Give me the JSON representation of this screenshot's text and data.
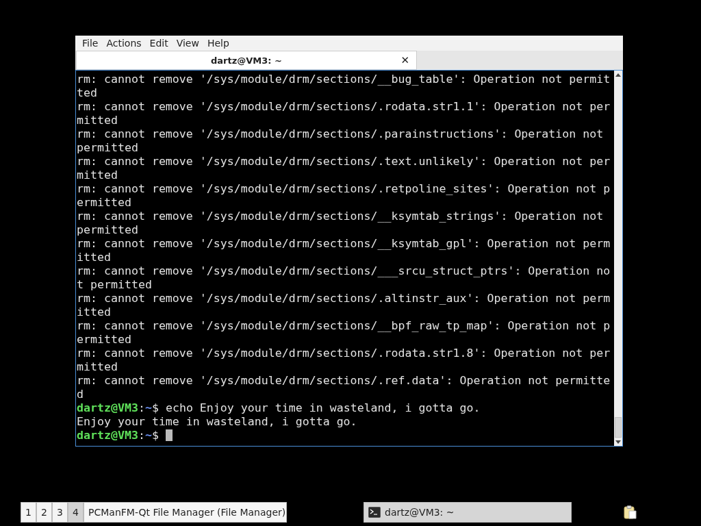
{
  "window": {
    "menu": [
      "File",
      "Actions",
      "Edit",
      "View",
      "Help"
    ],
    "tabs": [
      {
        "label": "dartz@VM3: ~",
        "selected": true,
        "close": "✕"
      }
    ],
    "terminal": {
      "lines": [
        {
          "kind": "output",
          "text": "rm: cannot remove '/sys/module/drm/sections/__bug_table': Operation not permit"
        },
        {
          "kind": "output",
          "text": "ted"
        },
        {
          "kind": "output",
          "text": "rm: cannot remove '/sys/module/drm/sections/.rodata.str1.1': Operation not per"
        },
        {
          "kind": "output",
          "text": "mitted"
        },
        {
          "kind": "output",
          "text": "rm: cannot remove '/sys/module/drm/sections/.parainstructions': Operation not"
        },
        {
          "kind": "output",
          "text": "permitted"
        },
        {
          "kind": "output",
          "text": "rm: cannot remove '/sys/module/drm/sections/.text.unlikely': Operation not per"
        },
        {
          "kind": "output",
          "text": "mitted"
        },
        {
          "kind": "output",
          "text": "rm: cannot remove '/sys/module/drm/sections/.retpoline_sites': Operation not p"
        },
        {
          "kind": "output",
          "text": "ermitted"
        },
        {
          "kind": "output",
          "text": "rm: cannot remove '/sys/module/drm/sections/__ksymtab_strings': Operation not"
        },
        {
          "kind": "output",
          "text": "permitted"
        },
        {
          "kind": "output",
          "text": "rm: cannot remove '/sys/module/drm/sections/__ksymtab_gpl': Operation not perm"
        },
        {
          "kind": "output",
          "text": "itted"
        },
        {
          "kind": "output",
          "text": "rm: cannot remove '/sys/module/drm/sections/___srcu_struct_ptrs': Operation no"
        },
        {
          "kind": "output",
          "text": "t permitted"
        },
        {
          "kind": "output",
          "text": "rm: cannot remove '/sys/module/drm/sections/.altinstr_aux': Operation not perm"
        },
        {
          "kind": "output",
          "text": "itted"
        },
        {
          "kind": "output",
          "text": "rm: cannot remove '/sys/module/drm/sections/__bpf_raw_tp_map': Operation not p"
        },
        {
          "kind": "output",
          "text": "ermitted"
        },
        {
          "kind": "output",
          "text": "rm: cannot remove '/sys/module/drm/sections/.rodata.str1.8': Operation not per"
        },
        {
          "kind": "output",
          "text": "mitted"
        },
        {
          "kind": "output",
          "text": "rm: cannot remove '/sys/module/drm/sections/.ref.data': Operation not permitte"
        },
        {
          "kind": "output",
          "text": "d"
        },
        {
          "kind": "prompt",
          "user": "dartz@VM3",
          "sep": ":",
          "path": "~",
          "symbol": "$",
          "command": "echo Enjoy your time in wasteland, i gotta go."
        },
        {
          "kind": "output",
          "text": "Enjoy your time in wasteland, i gotta go."
        },
        {
          "kind": "prompt",
          "user": "dartz@VM3",
          "sep": ":",
          "path": "~",
          "symbol": "$",
          "cursor": true
        }
      ]
    }
  },
  "taskbar": {
    "desktops": [
      {
        "label": "1",
        "selected": false
      },
      {
        "label": "2",
        "selected": false
      },
      {
        "label": "3",
        "selected": false
      },
      {
        "label": "4",
        "selected": true
      }
    ],
    "tasks": [
      {
        "label": "PCManFM-Qt File Manager (File Manager)",
        "selected": false,
        "kind": "plain"
      },
      {
        "label": "dartz@VM3: ~",
        "selected": true,
        "kind": "terminal"
      }
    ]
  }
}
